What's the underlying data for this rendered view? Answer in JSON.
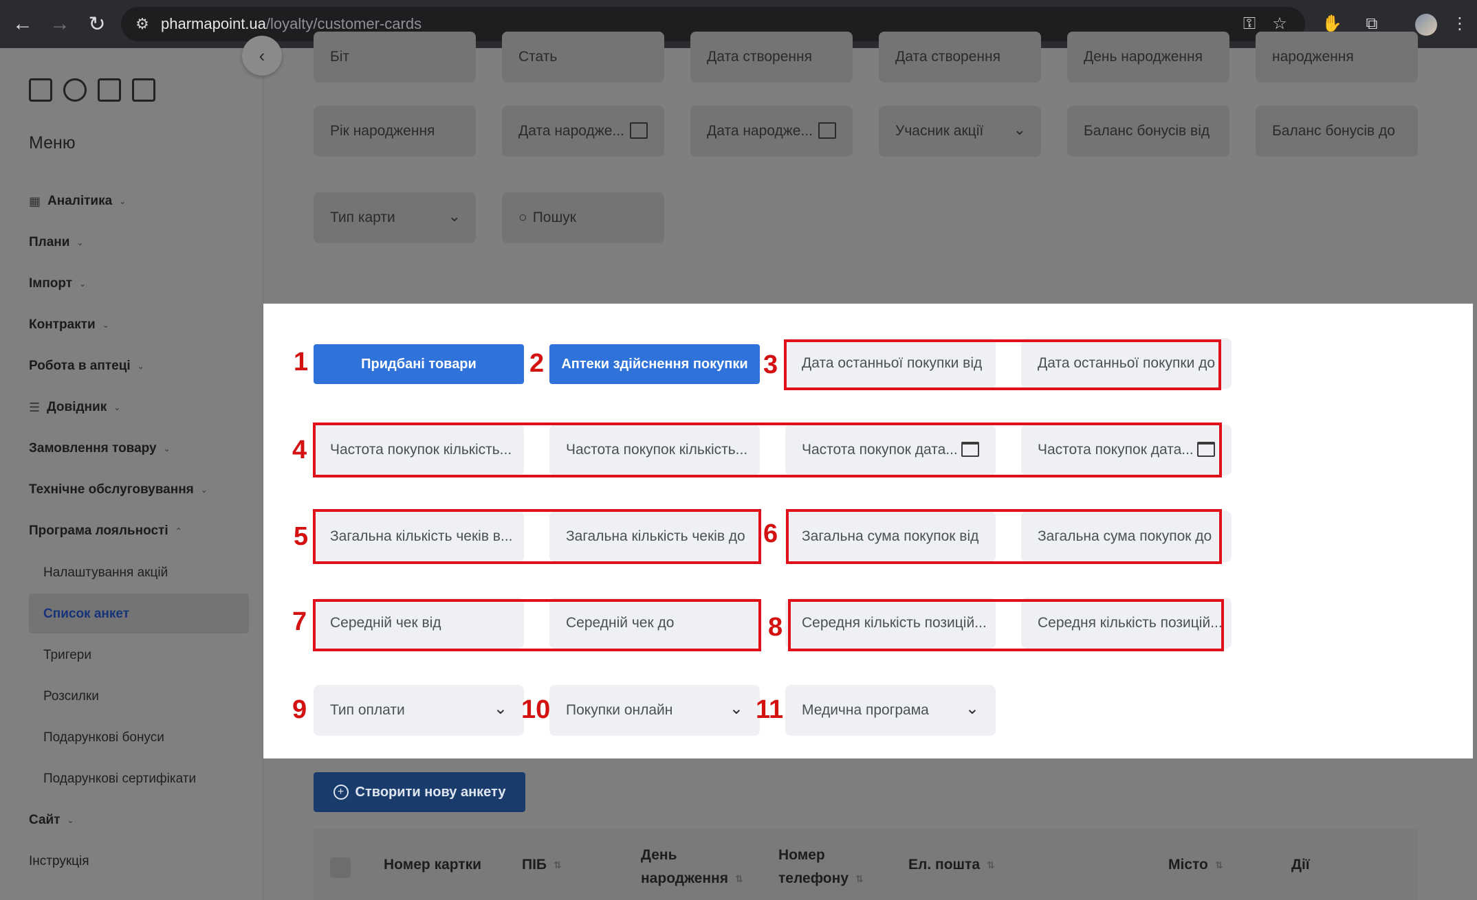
{
  "browser": {
    "url_domain": "pharmapoint.ua",
    "url_path": "/loyalty/customer-cards"
  },
  "sidebar": {
    "title": "Меню",
    "items": [
      {
        "label": "Аналітика",
        "has_icon": true
      },
      {
        "label": "Плани"
      },
      {
        "label": "Імпорт"
      },
      {
        "label": "Контракти"
      },
      {
        "label": "Робота в аптеці"
      },
      {
        "label": "Довідник",
        "has_icon": true
      },
      {
        "label": "Замовлення товару"
      },
      {
        "label": "Технічне обслуговування"
      },
      {
        "label": "Програма лояльності",
        "expanded": true
      }
    ],
    "subitems": [
      {
        "label": "Налаштування акцій"
      },
      {
        "label": "Список анкет",
        "active": true
      },
      {
        "label": "Тригери"
      },
      {
        "label": "Розсилки"
      },
      {
        "label": "Подарункові бонуси"
      },
      {
        "label": "Подарункові сертифікати"
      }
    ],
    "bottom_items": [
      {
        "label": "Сайт"
      },
      {
        "label": "Інструкція"
      }
    ]
  },
  "filters_top": {
    "row0_partial": [
      "Біт",
      "Стать",
      "Дата створення",
      "Дата створення",
      "День народження",
      "народження"
    ],
    "row1": [
      "Рік народження",
      "Дата народже...",
      "Дата народже...",
      "Учасник акції",
      "Баланс бонусів від",
      "Баланс бонусів до"
    ],
    "row2": [
      "Тип карти",
      "Пошук"
    ]
  },
  "panel": {
    "btn1": "Придбані товари",
    "btn2": "Аптеки здійснення покупки",
    "f3a": "Дата останньої покупки від",
    "f3b": "Дата останньої покупки до",
    "f4a": "Частота покупок кількість...",
    "f4b": "Частота покупок кількість...",
    "f4c": "Частота покупок дата...",
    "f4d": "Частота покупок дата...",
    "f5a": "Загальна кількість чеків в...",
    "f5b": "Загальна кількість чеків до",
    "f6a": "Загальна сума покупок від",
    "f6b": "Загальна сума покупок до",
    "f7a": "Середній чек від",
    "f7b": "Середній чек до",
    "f8a": "Середня кількість позицій...",
    "f8b": "Середня кількість позицій...",
    "f9": "Тип оплати",
    "f10": "Покупки онлайн",
    "f11": "Медична програма"
  },
  "annotations": [
    "1",
    "2",
    "3",
    "4",
    "5",
    "6",
    "7",
    "8",
    "9",
    "10",
    "11"
  ],
  "create_button": "Створити нову анкету",
  "table": {
    "columns": [
      "Номер картки",
      "ПІБ",
      "День народження",
      "Номер телефону",
      "Ел. пошта",
      "Місто",
      "Дії"
    ]
  },
  "colors": {
    "primary_button": "#2f72d9",
    "annotation_red": "#e0101b",
    "active_menu": "#16337a"
  }
}
